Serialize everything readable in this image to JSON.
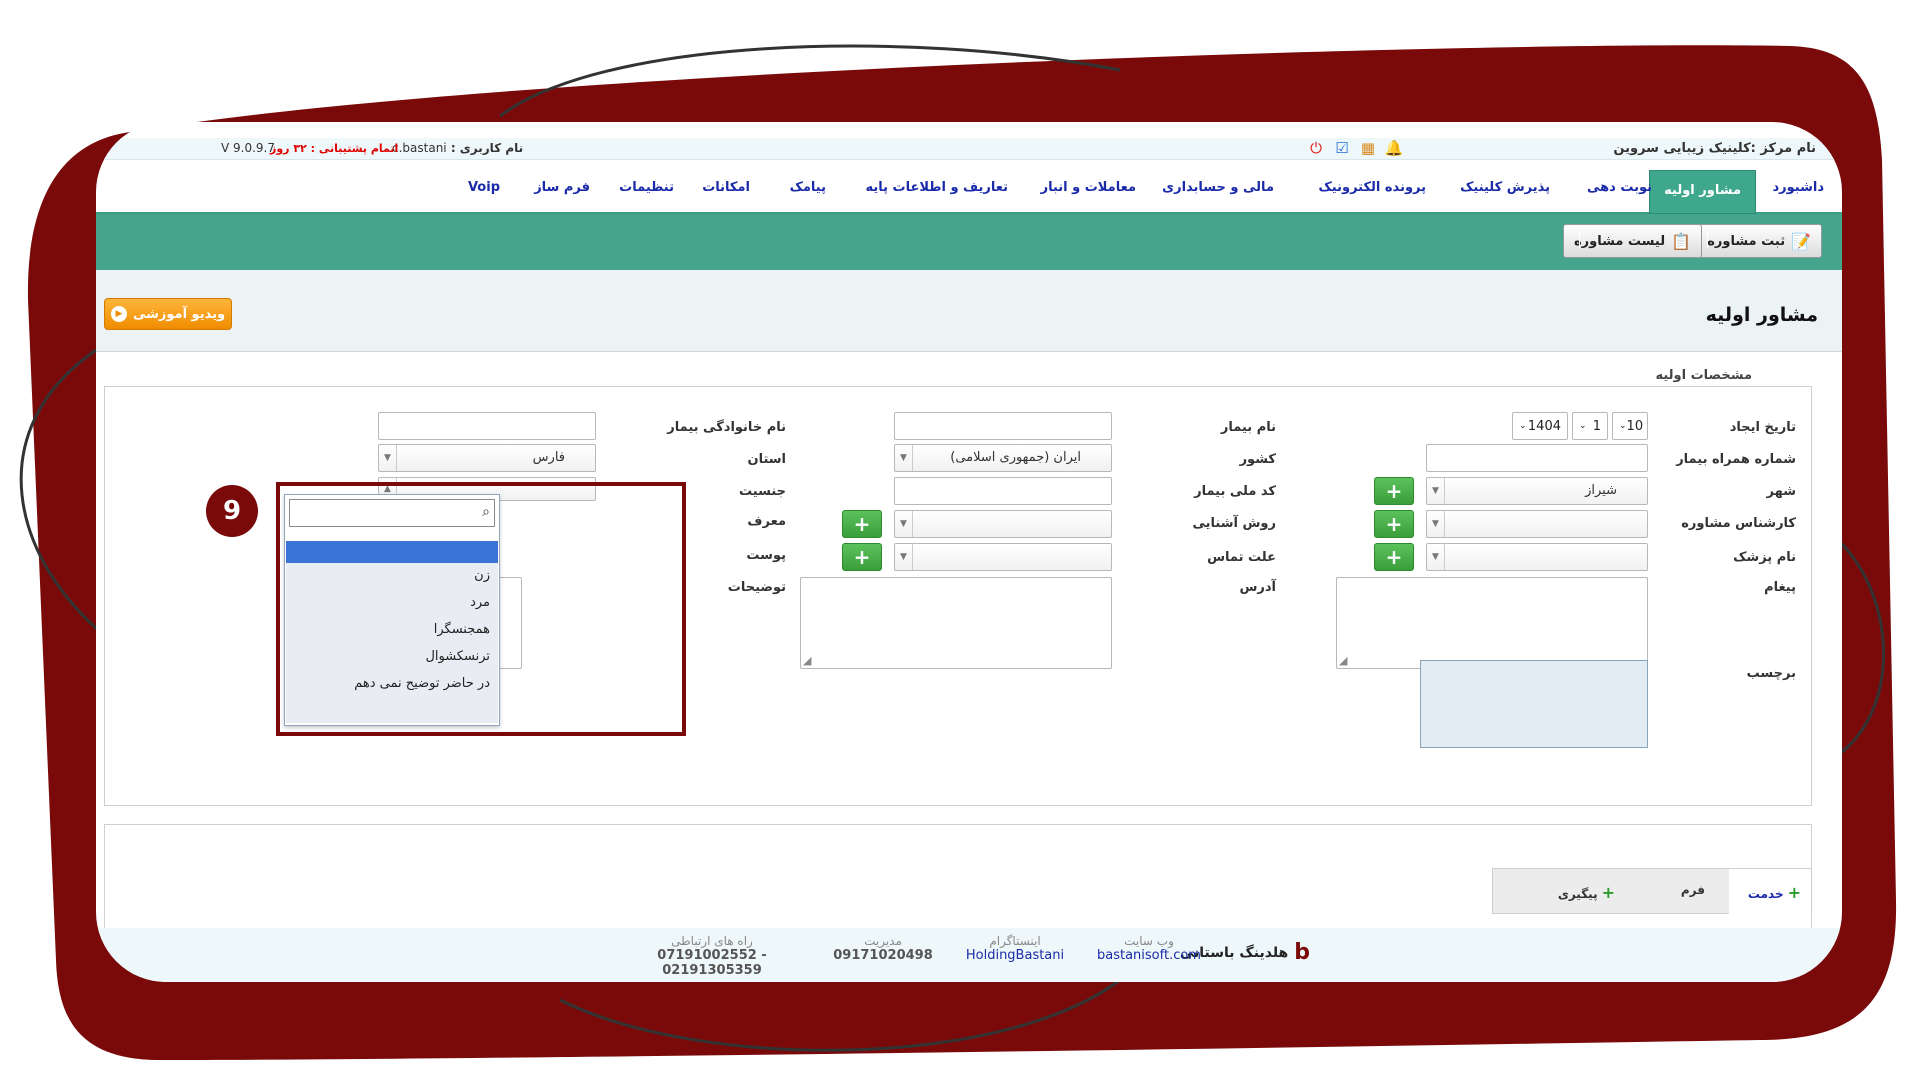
{
  "header": {
    "center_name": "نام مرکز :کلینیک زیبایی سروین",
    "user_label": "نام کاربری :",
    "username": "c.bastani",
    "support": "اتمام پشتیبانی : ۳۲ روز",
    "version": "V 9.0.9.7"
  },
  "nav": {
    "items": [
      "داشبورد",
      "مشاور اولیه",
      "نوبت دهی",
      "پذیرش کلینیک",
      "پرونده الکترونیک",
      "مالی و حسابداری",
      "معاملات و انبار",
      "تعاریف و اطلاعات پایه",
      "پیامک",
      "امکانات",
      "تنظیمات",
      "فرم ساز",
      "Voip"
    ]
  },
  "toolbar": {
    "register": "ثبت مشاوره",
    "list": "لیست مشاوره"
  },
  "page": {
    "title": "مشاور اولیه",
    "video_button": "ویدیو آموزشی",
    "legend": "مشخصات اولیه"
  },
  "form": {
    "created_date_label": "تاریخ ایجاد",
    "date_day": "10",
    "date_month": "1",
    "date_year": "1404",
    "patient_mobile_label": "شماره همراه بیمار",
    "city_label": "شهر",
    "city_value": "شیراز",
    "consultant_label": "کارشناس مشاوره",
    "doctor_label": "نام پزشک",
    "message_label": "پیغام",
    "tag_label": "برچسب",
    "patient_name_label": "نام بیمار",
    "country_label": "کشور",
    "country_value": "ایران (جمهوری اسلامی)",
    "national_code_label": "کد ملی بیمار",
    "acquaint_label": "روش آشنایی",
    "contact_reason_label": "علت تماس",
    "address_label": "آدرس",
    "family_label": "نام خانوادگی بیمار",
    "province_label": "استان",
    "province_value": "فارس",
    "gender_label": "جنسیت",
    "referrer_label": "معرف",
    "skin_label": "پوست",
    "notes_label": "توضیحات"
  },
  "gender_dropdown": {
    "search_value": "",
    "options": [
      "",
      "زن",
      "مرد",
      "همجنسگرا",
      "ترنسکشوال",
      "در حاضر توضیح نمی دهم"
    ],
    "highlighted_index": 0
  },
  "annotation": {
    "step_number": "9"
  },
  "bottom_tabs": {
    "service": "خدمت",
    "form": "فرم",
    "followup": "پیگیری"
  },
  "footer": {
    "brand": "هلدینگ باستانی",
    "website_caption": "وب سایت",
    "website": "bastanisoft.com",
    "instagram_caption": "اینستاگرام",
    "instagram": "HoldingBastani",
    "management_caption": "مدیریت",
    "management": "09171020498",
    "contacts_caption": "راه های ارتباطی",
    "contacts": "07191002552 - 02191305359"
  },
  "colors": {
    "frame": "#7a0a0a",
    "nav_active": "#3fa88c",
    "toolbar": "#44a48c",
    "video_button": "#f39a10",
    "plus_button": "#4cb14c",
    "nav_text": "#1a2aa8"
  },
  "icons": [
    "power-icon",
    "calendar-check-icon",
    "calendar-icon",
    "bell-icon",
    "add-note-icon",
    "clipboard-icon",
    "play-icon",
    "search-icon",
    "plus-icon",
    "brand-logo-icon"
  ]
}
